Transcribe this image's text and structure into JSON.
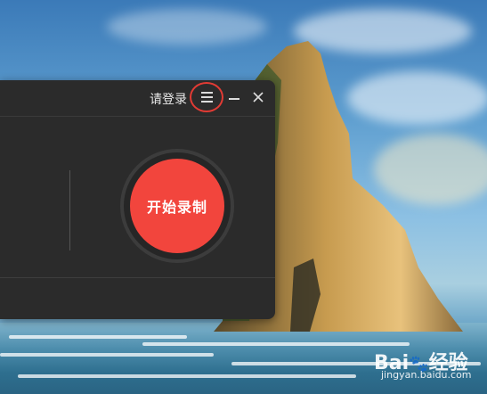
{
  "header": {
    "login_text": "请登录"
  },
  "main": {
    "record_label": "开始录制"
  },
  "icons": {
    "menu": "menu-icon",
    "minimize": "minimize-icon",
    "close": "close-icon"
  },
  "watermark": {
    "brand_left": "Bai",
    "brand_right": "经验",
    "url": "jingyan.baidu.com"
  },
  "colors": {
    "record_button": "#f2453d",
    "highlight_ring": "#e23b34",
    "window_bg": "#2b2b2b"
  }
}
